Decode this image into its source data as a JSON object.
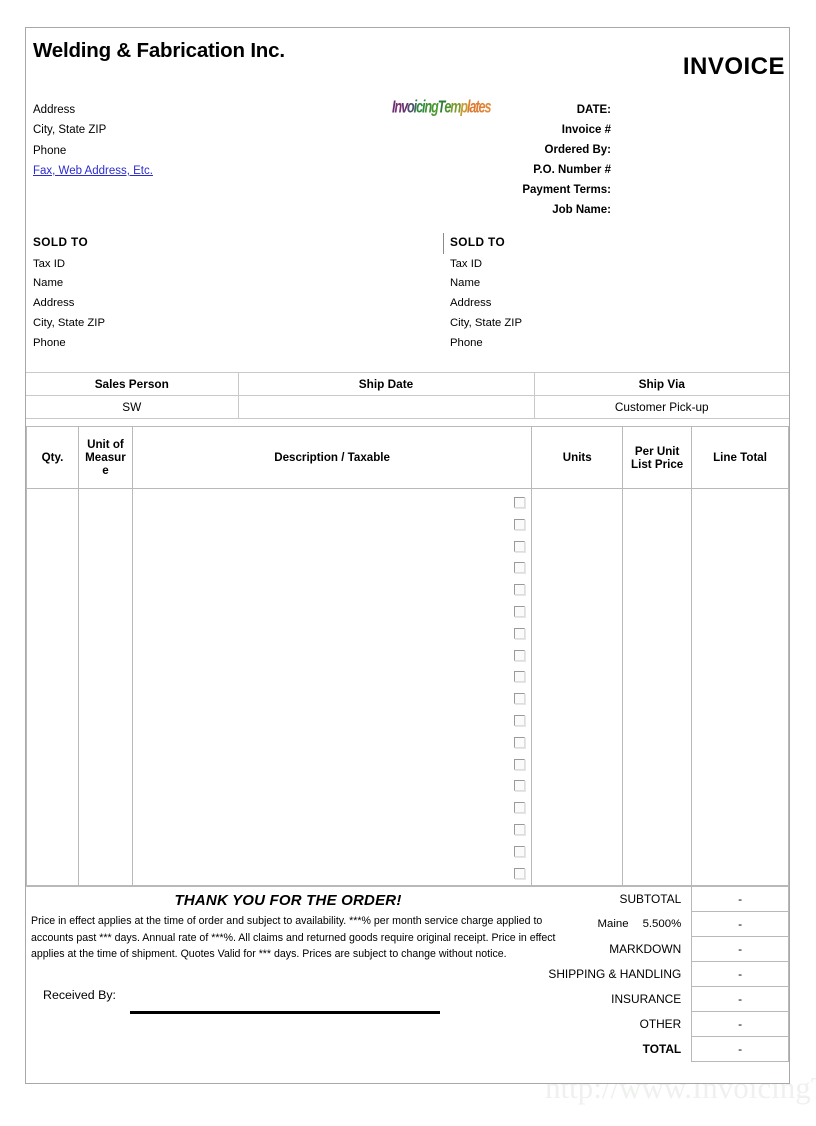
{
  "document": {
    "title_word": "INVOICE",
    "company_name": "Welding & Fabrication Inc.",
    "watermark": "http://www.InvoicingTemplate.com"
  },
  "logo": {
    "letters": [
      {
        "ch": "I",
        "color": "#6b2f7a"
      },
      {
        "ch": "n",
        "color": "#7a2f74"
      },
      {
        "ch": "v",
        "color": "#62306f"
      },
      {
        "ch": "o",
        "color": "#4e4f6e"
      },
      {
        "ch": "i",
        "color": "#3f6a5a"
      },
      {
        "ch": "c",
        "color": "#2f8a3f"
      },
      {
        "ch": "i",
        "color": "#2f8a3f"
      },
      {
        "ch": "n",
        "color": "#3f922f"
      },
      {
        "ch": "g",
        "color": "#4a9a2f"
      },
      {
        "ch": "T",
        "color": "#2f7a3a"
      },
      {
        "ch": "e",
        "color": "#4f8f2f"
      },
      {
        "ch": "m",
        "color": "#7a9b2f"
      },
      {
        "ch": "p",
        "color": "#c89a2f"
      },
      {
        "ch": "l",
        "color": "#d4802f"
      },
      {
        "ch": "a",
        "color": "#dd7a2f"
      },
      {
        "ch": "t",
        "color": "#e07a33"
      },
      {
        "ch": "e",
        "color": "#e08033"
      },
      {
        "ch": "s",
        "color": "#e08a3a"
      }
    ]
  },
  "company_address": {
    "lines": [
      "Address",
      "City, State ZIP",
      "Phone"
    ],
    "link_line": "Fax, Web Address, Etc."
  },
  "header_fields": [
    "DATE:",
    "Invoice #",
    "Ordered By:",
    "P.O. Number #",
    "Payment Terms:",
    "Job Name:"
  ],
  "sold_to_left": {
    "title": "SOLD  TO",
    "lines": [
      "Tax ID",
      "Name",
      "Address",
      "City, State ZIP",
      "Phone"
    ]
  },
  "sold_to_right": {
    "title": "SOLD  TO",
    "lines": [
      "Tax ID",
      "Name",
      "Address",
      "City, State ZIP",
      "Phone"
    ]
  },
  "ship_table": {
    "headers": [
      "Sales Person",
      "Ship Date",
      "Ship Via"
    ],
    "values": [
      "SW",
      "",
      "Customer Pick-up"
    ]
  },
  "items_table": {
    "headers": {
      "qty": "Qty.",
      "uom": "Unit of Measur e",
      "description": "Description  / Taxable",
      "units": "Units",
      "price": "Per  Unit List Price",
      "line_total": "Line Total"
    },
    "checkbox_count": 18,
    "rows": []
  },
  "footer": {
    "thank_you": "THANK YOU FOR THE ORDER!",
    "terms": "Price in effect applies at the time of order and subject to availability. ***% per month service charge applied to accounts past *** days. Annual rate of ***%. All claims and returned goods require original receipt. Price in effect applies at the time of shipment. Quotes Valid for *** days. Prices are subject to change without notice.",
    "received_by": "Received By:"
  },
  "totals": {
    "rows": [
      {
        "label": "SUBTOTAL",
        "value": "-",
        "type": "plain"
      },
      {
        "label": "Maine",
        "rate": "5.500%",
        "value": "-",
        "type": "tax"
      },
      {
        "label": "MARKDOWN",
        "value": "-",
        "type": "plain"
      },
      {
        "label": "SHIPPING & HANDLING",
        "value": "-",
        "type": "plain"
      },
      {
        "label": "INSURANCE",
        "value": "-",
        "type": "plain"
      },
      {
        "label": "OTHER",
        "value": "-",
        "type": "plain"
      },
      {
        "label": "TOTAL",
        "value": "-",
        "type": "total"
      }
    ]
  },
  "colors": {
    "border": "#b9b9b9",
    "link": "#2b2bcf",
    "watermark": "#eef1ee"
  }
}
